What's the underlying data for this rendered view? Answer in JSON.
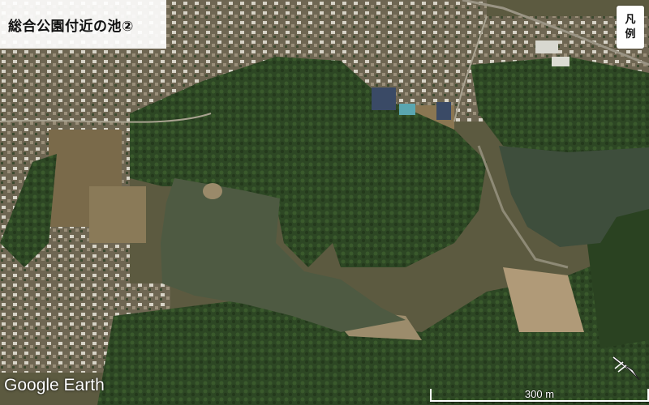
{
  "title": "総合公園付近の池②",
  "legend": {
    "line1": "凡",
    "line2": "例"
  },
  "watermark": "Google Earth",
  "scale": {
    "label": "300 m"
  },
  "compass": {
    "icon": "compass-arrow-icon"
  },
  "colors": {
    "forest": "#2f4a26",
    "pond": "#4e5a42",
    "farmland": "#7a6a4a",
    "mudflat": "#b09a78"
  }
}
